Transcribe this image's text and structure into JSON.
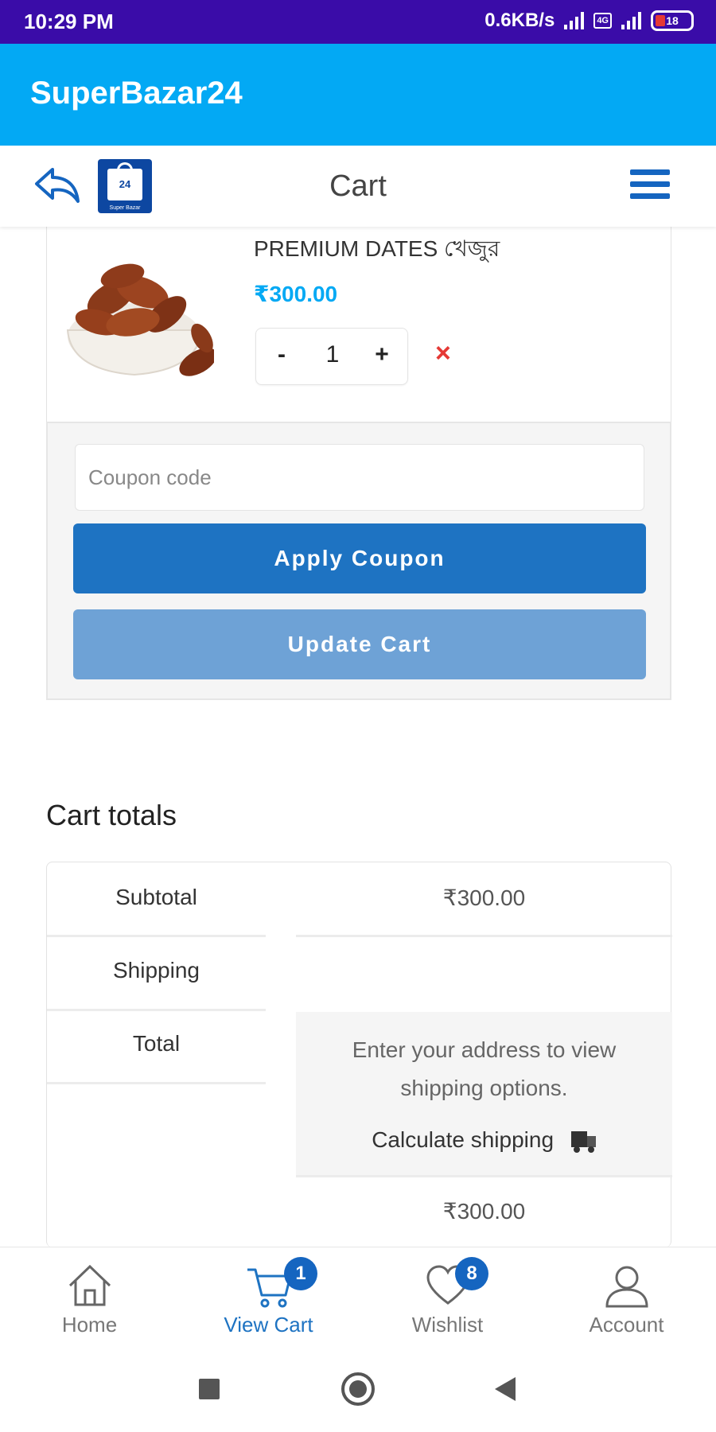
{
  "status_bar": {
    "time": "10:29 PM",
    "net_speed": "0.6KB/s",
    "sim_tag": "4G",
    "battery": "18"
  },
  "app_bar": {
    "title": "SuperBazar24"
  },
  "header": {
    "title": "Cart",
    "logo_number": "24",
    "logo_text": "Super Bazar"
  },
  "cart_item": {
    "name": "PREMIUM DATES খেজুর",
    "price": "₹300.00",
    "quantity": "1",
    "minus_label": "-",
    "plus_label": "+",
    "remove_label": "×"
  },
  "coupon": {
    "placeholder": "Coupon code",
    "apply_label": "Apply Coupon",
    "update_label": "Update Cart"
  },
  "totals": {
    "heading": "Cart totals",
    "subtotal_label": "Subtotal",
    "subtotal_value": "₹300.00",
    "shipping_label": "Shipping",
    "total_label": "Total",
    "shipping_message": "Enter your address to view shipping options.",
    "calculate_shipping_label": "Calculate shipping",
    "total_value": "₹300.00"
  },
  "bottom_nav": {
    "items": [
      {
        "label": "Home",
        "icon": "home-icon"
      },
      {
        "label": "View Cart",
        "icon": "cart-icon",
        "badge": "1"
      },
      {
        "label": "Wishlist",
        "icon": "heart-icon",
        "badge": "8"
      },
      {
        "label": "Account",
        "icon": "user-icon"
      }
    ]
  },
  "colors": {
    "status_bar": "#3a0ca8",
    "app_bar": "#03a9f4",
    "primary_button": "#1e73c2",
    "secondary_button": "#6ea2d6",
    "price": "#03a9f4",
    "remove": "#e53935"
  }
}
